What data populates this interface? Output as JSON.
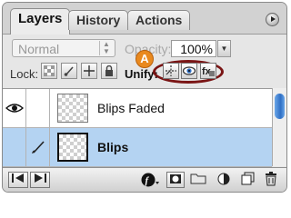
{
  "tabs": [
    {
      "label": "Layers"
    },
    {
      "label": "History"
    },
    {
      "label": "Actions"
    }
  ],
  "blend_mode": {
    "selected": "Normal"
  },
  "opacity": {
    "label": "Opacity:",
    "value": "100%"
  },
  "lock": {
    "label": "Lock:"
  },
  "unify": {
    "label": "Unify:",
    "callout": "A"
  },
  "layers": [
    {
      "name": "Blips Faded",
      "visible": true,
      "selected": false
    },
    {
      "name": "Blips",
      "visible": false,
      "selected": true
    }
  ],
  "colors": {
    "selection": "#b4d3f2",
    "callout": "#e9891e",
    "highlight_ellipse": "#7a1515",
    "scroll_thumb": "#2f6fc4"
  }
}
